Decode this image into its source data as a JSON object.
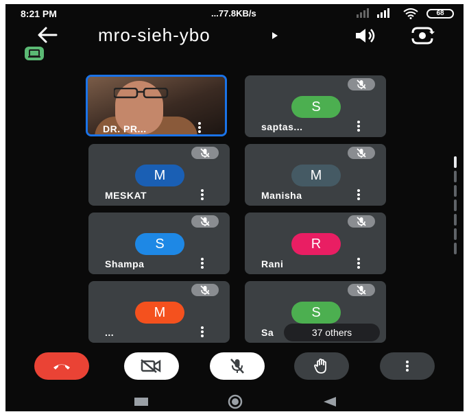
{
  "status_bar": {
    "time": "8:21 PM",
    "network_speed": "...77.8KB/s",
    "battery": "68"
  },
  "header": {
    "meeting_code": "mro-sieh-ybo"
  },
  "participants": [
    {
      "name": "DR. PR...",
      "initial": "",
      "color": "",
      "muted": false,
      "video": true
    },
    {
      "name": "saptas...",
      "initial": "S",
      "color": "#4caf50",
      "muted": true,
      "video": false
    },
    {
      "name": "MESKAT",
      "initial": "M",
      "color": "#1a5fb4",
      "muted": true,
      "video": false
    },
    {
      "name": "Manisha",
      "initial": "M",
      "color": "#455a64",
      "muted": true,
      "video": false
    },
    {
      "name": "Shampa",
      "initial": "S",
      "color": "#1e88e5",
      "muted": true,
      "video": false
    },
    {
      "name": "Rani",
      "initial": "R",
      "color": "#e91e63",
      "muted": true,
      "video": false
    },
    {
      "name": "...",
      "initial": "M",
      "color": "#f4511e",
      "muted": true,
      "video": false
    },
    {
      "name": "Sa",
      "initial": "S",
      "color": "#4caf50",
      "muted": true,
      "video": false
    }
  ],
  "others_label": "37 others",
  "controls": {
    "end_call_color": "#ea4335",
    "buttons": [
      "end-call",
      "camera-off",
      "mic-off",
      "raise-hand",
      "more-options"
    ]
  },
  "colors": {
    "background": "#0a0a0a",
    "tile": "#3c4043",
    "selected_border": "#1a73e8",
    "cast_badge": "#5bb974"
  }
}
